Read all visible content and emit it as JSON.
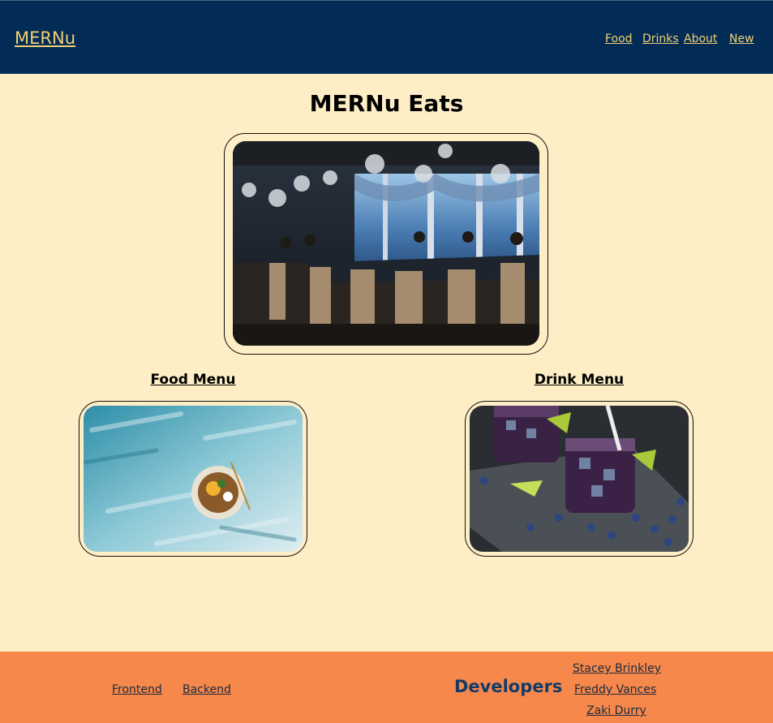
{
  "nav": {
    "brand": "MERNu",
    "links": [
      "Food",
      "Drinks",
      "About",
      "New"
    ]
  },
  "main": {
    "title": "MERNu Eats",
    "food_heading": "Food Menu",
    "drink_heading": "Drink Menu"
  },
  "footer": {
    "links": [
      "Frontend",
      "Backend"
    ],
    "developers_heading": "Developers",
    "developers": [
      "Stacey Brinkley",
      "Freddy Vances",
      "Zaki Durry"
    ]
  },
  "colors": {
    "navbar": "#022c55",
    "nav_text": "#f2cf76",
    "page_background": "#fdeec6",
    "footer": "#f5884a"
  }
}
